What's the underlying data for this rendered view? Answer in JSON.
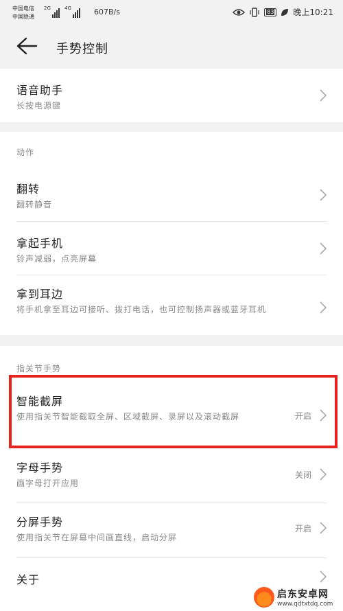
{
  "status_bar": {
    "carrier1": "中国电信",
    "carrier2": "中国联通",
    "net1": "2G",
    "net2": "4G",
    "speed": "607B/s",
    "battery": "83",
    "time": "晚上10:21"
  },
  "header": {
    "title": "手势控制"
  },
  "voice": {
    "title": "语音助手",
    "subtitle": "长按电源键"
  },
  "section_action": {
    "label": "动作",
    "items": [
      {
        "title": "翻转",
        "subtitle": "翻转静音"
      },
      {
        "title": "拿起手机",
        "subtitle": "铃声减弱，点亮屏幕"
      },
      {
        "title": "拿到耳边",
        "subtitle": "将手机拿至耳边可接听、拨打电话，也可控制扬声器或蓝牙耳机"
      }
    ]
  },
  "section_knuckle": {
    "label": "指关节手势",
    "items": [
      {
        "title": "智能截屏",
        "subtitle": "使用指关节智能截取全屏、区域截屏、录屏以及滚动截屏",
        "status": "开启"
      },
      {
        "title": "字母手势",
        "subtitle": "画字母打开应用",
        "status": "关闭"
      },
      {
        "title": "分屏手势",
        "subtitle": "使用指关节在屏幕中间画直线，启动分屏",
        "status": "开启"
      },
      {
        "title": "关于"
      }
    ]
  },
  "watermark": {
    "name": "启东安卓网",
    "url": "www.qdtxtdq.com"
  },
  "colors": {
    "highlight": "#e8231f",
    "background": "#f2f2f2"
  }
}
